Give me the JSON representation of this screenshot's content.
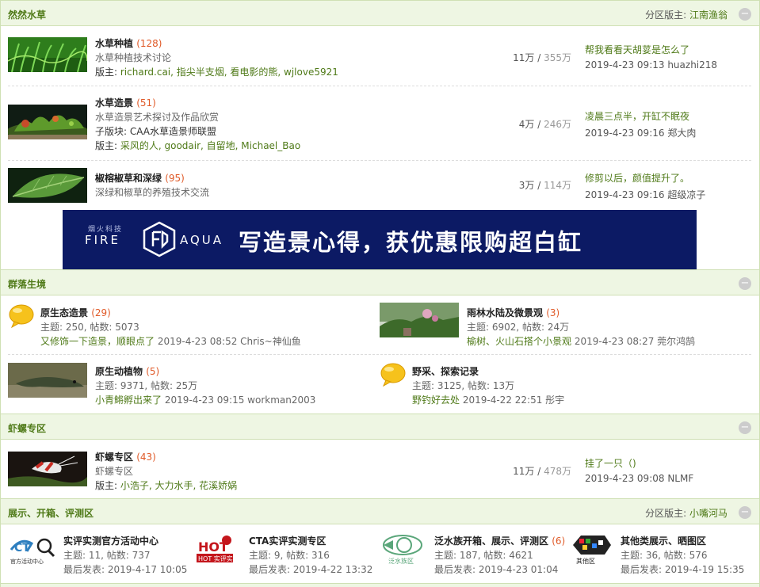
{
  "sections": {
    "shuicao": {
      "title": "然然水草",
      "moderator_label": "分区版主:",
      "moderator": "江南渔翁",
      "forums": [
        {
          "name": "水草种植",
          "count": "(128)",
          "desc": "水草种植技术讨论",
          "mod_label": "版主:",
          "mods": "richard.cai, 指尖半支烟, 看电影的熊, wjlove5921",
          "threads": "11万",
          "posts": "355万",
          "last_title": "帮我看看天胡荽是怎么了",
          "last_time": "2019-4-23 09:13",
          "last_user": "huazhi218"
        },
        {
          "name": "水草造景",
          "count": "(51)",
          "desc": "水草造景艺术探讨及作品欣赏",
          "sub_label": "子版块:",
          "sub": "CAA水草造景师联盟",
          "mod_label": "版主:",
          "mods": "采风的人, goodair, 自留地, Michael_Bao",
          "threads": "4万",
          "posts": "246万",
          "last_title": "凌晨三点半，开缸不眠夜",
          "last_time": "2019-4-23 09:16",
          "last_user": "郑大肉"
        },
        {
          "name": "椒榕椒草和深绿",
          "count": "(95)",
          "desc": "深绿和椒草的养殖技术交流",
          "threads": "3万",
          "posts": "114万",
          "last_title": "修剪以后，颜值提升了。",
          "last_time": "2019-4-23 09:16",
          "last_user": "超级凉子"
        }
      ]
    },
    "banner": {
      "brand_top": "烟火科技",
      "brand_fire": "FIRE",
      "brand_aqua": "AQUA",
      "slogan": "写造景心得，获优惠限购超白缸"
    },
    "qunluo": {
      "title": "群落生境",
      "forums": [
        {
          "name": "原生态造景",
          "count": "(29)",
          "stats": "主题: 250, 帖数: 5073",
          "last_title": "又修饰一下造景，顺眼点了",
          "last_time": "2019-4-23 08:52",
          "last_user": "Chris~神仙鱼"
        },
        {
          "name": "雨林水陆及微景观",
          "count": "(3)",
          "stats": "主题: 6902, 帖数: 24万",
          "last_title": "榆树、火山石搭个小景观",
          "last_time": "2019-4-23 08:27",
          "last_user": "莞尔鸿鹄"
        },
        {
          "name": "原生动植物",
          "count": "(5)",
          "stats": "主题: 9371, 帖数: 25万",
          "last_title": "小青鳉孵出来了",
          "last_time": "2019-4-23 09:15",
          "last_user": "workman2003"
        },
        {
          "name": "野采、探索记录",
          "stats": "主题: 3125, 帖数: 13万",
          "last_title": "野钓好去处",
          "last_time": "2019-4-22 22:51",
          "last_user": "彤宇"
        }
      ]
    },
    "xialuo": {
      "title": "虾螺专区",
      "forums": [
        {
          "name": "虾螺专区",
          "count": "(43)",
          "desc": "虾螺专区",
          "mod_label": "版主:",
          "mods": "小浩子, 大力水手, 花溪娇娲",
          "threads": "11万",
          "posts": "478万",
          "last_title": "挂了一只（)",
          "last_time": "2019-4-23 09:08",
          "last_user": "NLMF"
        }
      ]
    },
    "zhanshi": {
      "title": "展示、开箱、评测区",
      "moderator_label": "分区版主:",
      "moderator": "小嘴河马",
      "forums": [
        {
          "name": "实评实测官方活动中心",
          "stats": "主题: 11, 帖数: 737",
          "last": "最后发表: 2019-4-17 10:05",
          "icon_text": "官方活动中心"
        },
        {
          "name": "CTA实评实测专区",
          "stats": "主题: 9, 帖数: 316",
          "last": "最后发表: 2019-4-22 13:32",
          "icon_text": "HOT 实评实测"
        },
        {
          "name": "泛水族开箱、展示、评测区",
          "count": "(6)",
          "stats": "主题: 187, 帖数: 4621",
          "last": "最后发表: 2019-4-23 01:04",
          "icon_text": "泛水族区"
        },
        {
          "name": "其他类展示、晒图区",
          "stats": "主题: 36, 帖数: 576",
          "last": "最后发表: 2019-4-19 15:35",
          "icon_text": "其他区"
        }
      ]
    },
    "collapse_symbol": "−"
  },
  "colors": {
    "header_bg": "#eef6e3",
    "accent_green": "#4f7a18",
    "count_orange": "#e05a28",
    "banner_bg": "#0c1a64"
  }
}
